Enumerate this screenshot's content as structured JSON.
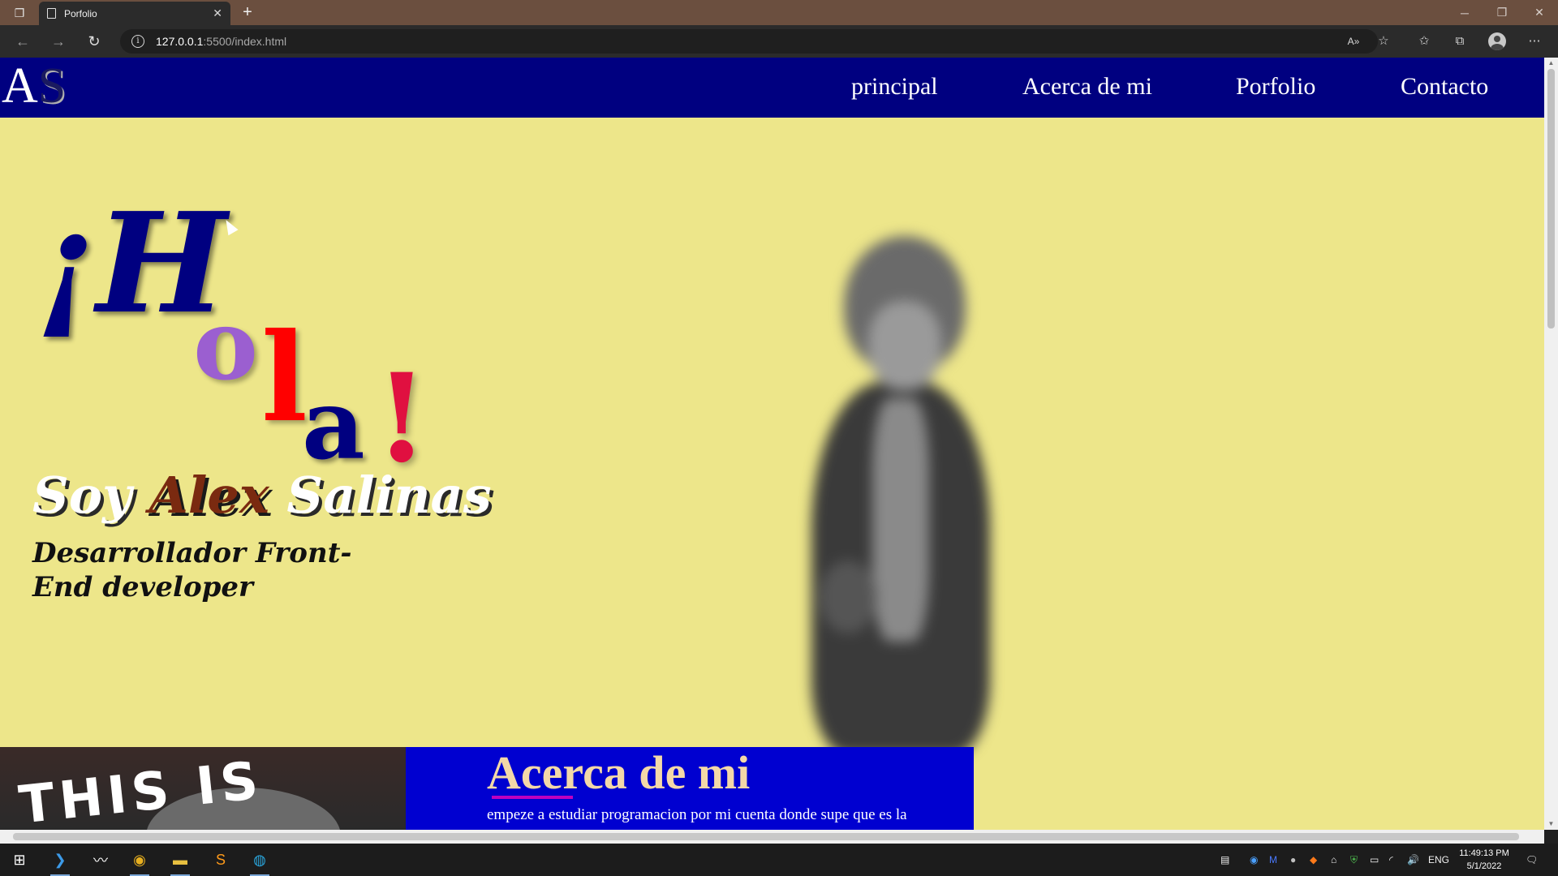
{
  "browser": {
    "tab_title": "Porfolio",
    "url_host": "127.0.0.1",
    "url_path": ":5500/index.html"
  },
  "site": {
    "logo_a": "A",
    "logo_s": "S",
    "nav": [
      "principal",
      "Acerca de mi",
      "Porfolio",
      "Contacto"
    ],
    "hero": {
      "hola": [
        "¡H",
        "o",
        "l",
        "a",
        "!"
      ],
      "soy": [
        "Soy",
        "Alex",
        "Salinas"
      ],
      "subtitle": "Desarrollador Front-End developer"
    },
    "banner_text": "THIS IS FINE",
    "about": {
      "title": "Acerca de mi",
      "text": "empeze a estudiar programacion por mi cuenta donde supe que es la"
    }
  },
  "taskbar": {
    "lang": "ENG",
    "time": "11:49:13 PM",
    "date": "5/1/2022"
  }
}
